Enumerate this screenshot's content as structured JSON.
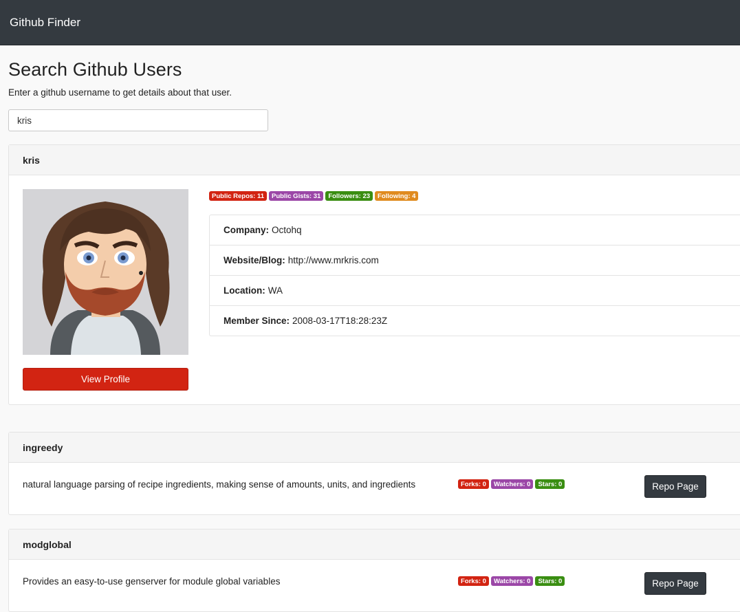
{
  "navbar": {
    "title": "Github Finder"
  },
  "search": {
    "heading": "Search Github Users",
    "description": "Enter a github username to get details about that user.",
    "value": "kris"
  },
  "profile": {
    "username": "kris",
    "view_profile_label": "View Profile",
    "badges": {
      "public_repos": "Public Repos: 11",
      "public_gists": "Public Gists: 31",
      "followers": "Followers: 23",
      "following": "Following: 4"
    },
    "details": [
      {
        "label": "Company:",
        "value": "Octohq"
      },
      {
        "label": "Website/Blog:",
        "value": "http://www.mrkris.com"
      },
      {
        "label": "Location:",
        "value": "WA"
      },
      {
        "label": "Member Since:",
        "value": "2008-03-17T18:28:23Z"
      }
    ]
  },
  "repos": [
    {
      "name": "ingreedy",
      "description": "natural language parsing of recipe ingredients, making sense of amounts, units, and ingredients",
      "forks": "Forks: 0",
      "watchers": "Watchers: 0",
      "stars": "Stars: 0",
      "button_label": "Repo Page"
    },
    {
      "name": "modglobal",
      "description": "Provides an easy-to-use genserver for module global variables",
      "forks": "Forks: 0",
      "watchers": "Watchers: 0",
      "stars": "Stars: 0",
      "button_label": "Repo Page"
    }
  ],
  "colors": {
    "navbar": "#343a40",
    "danger": "#d22412",
    "purple": "#9b47a7",
    "success": "#3a8e12",
    "warning": "#e08b1f"
  }
}
